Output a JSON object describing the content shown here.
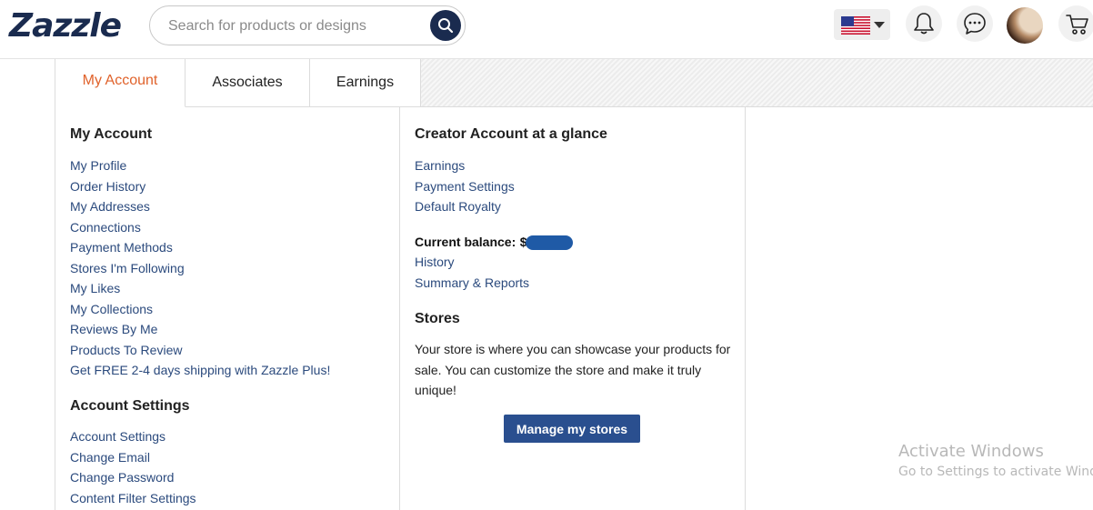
{
  "header": {
    "logo": "Zazzle",
    "search": {
      "placeholder": "Search for products or designs",
      "value": ""
    },
    "icons": [
      "us-flag-icon",
      "chevron-down-icon",
      "bell-icon",
      "chat-icon",
      "avatar",
      "cart-icon"
    ]
  },
  "tabs": [
    {
      "label": "My Account",
      "active": true
    },
    {
      "label": "Associates",
      "active": false
    },
    {
      "label": "Earnings",
      "active": false
    }
  ],
  "my_account": {
    "title": "My Account",
    "links": [
      "My Profile",
      "Order History",
      "My Addresses",
      "Connections",
      "Payment Methods",
      "Stores I'm Following",
      "My Likes",
      "My Collections",
      "Reviews By Me",
      "Products To Review",
      "Get FREE 2-4 days shipping with Zazzle Plus!"
    ]
  },
  "account_settings": {
    "title": "Account Settings",
    "links": [
      "Account Settings",
      "Change Email",
      "Change Password",
      "Content Filter Settings"
    ]
  },
  "creator": {
    "title": "Creator Account at a glance",
    "links": [
      "Earnings",
      "Payment Settings",
      "Default Royalty"
    ],
    "balance_label": "Current balance:",
    "balance_currency": "$",
    "balance_links": [
      "History",
      "Summary & Reports"
    ]
  },
  "stores": {
    "title": "Stores",
    "description": "Your store is where you can showcase your products for sale. You can customize the store and make it truly unique!",
    "button": "Manage my stores"
  },
  "watermark": {
    "line1": "Activate Windows",
    "line2": "Go to Settings to activate Windo"
  },
  "colors": {
    "brand_navy": "#1a2b4f",
    "active_tab": "#e0622b",
    "link": "#2b4a7d",
    "button": "#2a4f8f"
  }
}
